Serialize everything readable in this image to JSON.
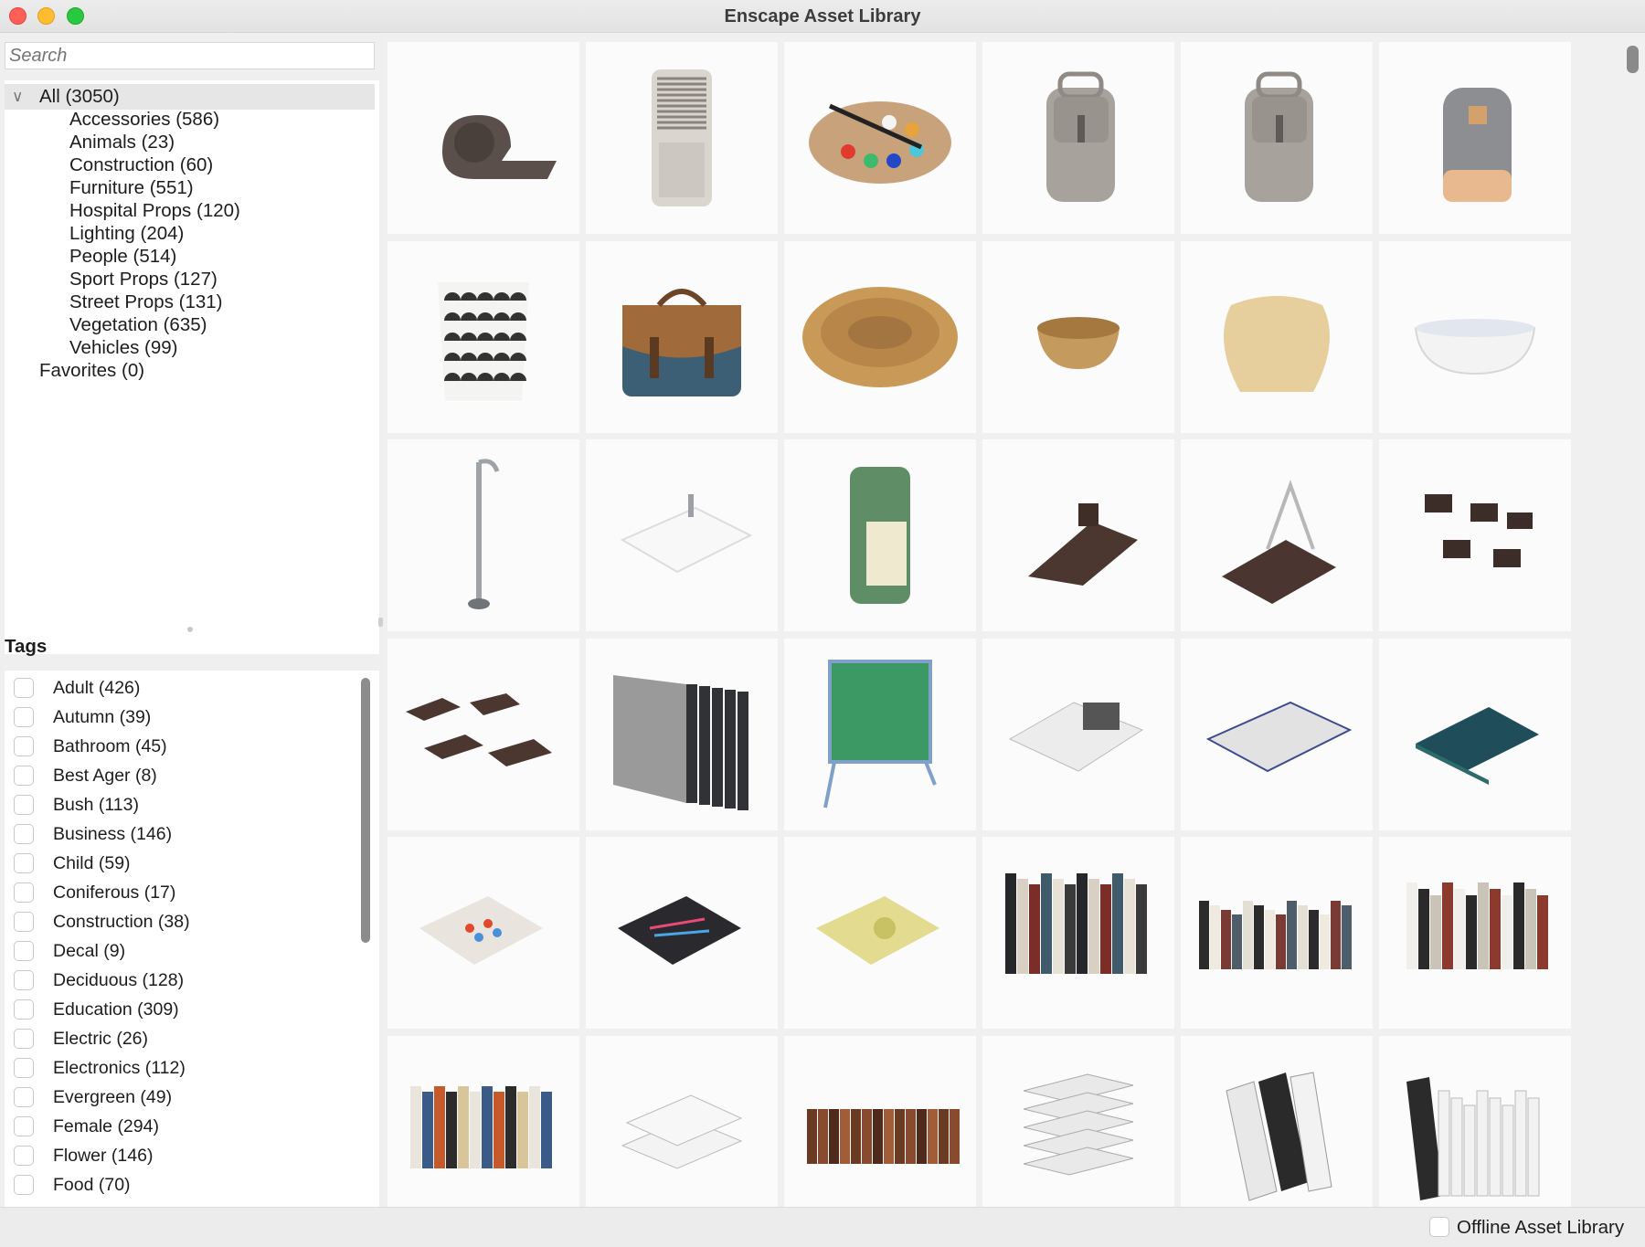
{
  "window": {
    "title": "Enscape Asset Library"
  },
  "search": {
    "placeholder": "Search"
  },
  "categories": {
    "all": "All (3050)",
    "items": [
      "Accessories (586)",
      "Animals (23)",
      "Construction (60)",
      "Furniture (551)",
      "Hospital Props (120)",
      "Lighting (204)",
      "People (514)",
      "Sport Props (127)",
      "Street Props (131)",
      "Vegetation (635)",
      "Vehicles (99)"
    ],
    "favorites": "Favorites (0)"
  },
  "tags": {
    "title": "Tags",
    "items": [
      "Adult (426)",
      "Autumn (39)",
      "Bathroom (45)",
      "Best Ager (8)",
      "Bush (113)",
      "Business (146)",
      "Child (59)",
      "Coniferous (17)",
      "Construction (38)",
      "Decal (9)",
      "Deciduous (128)",
      "Education (309)",
      "Electric (26)",
      "Electronics (112)",
      "Evergreen (49)",
      "Female (294)",
      "Flower (146)",
      "Food (70)"
    ]
  },
  "assets": [
    {
      "name": "tape-dispenser",
      "icon": "tape"
    },
    {
      "name": "air-cooler",
      "icon": "cooler"
    },
    {
      "name": "paint-palette",
      "icon": "palette"
    },
    {
      "name": "backpack-beige",
      "icon": "backpack"
    },
    {
      "name": "backpack-tan",
      "icon": "backpack"
    },
    {
      "name": "backpack-grey",
      "icon": "backpack2"
    },
    {
      "name": "laundry-basket",
      "icon": "hamper"
    },
    {
      "name": "messenger-bag",
      "icon": "bag"
    },
    {
      "name": "wicker-basket",
      "icon": "basket"
    },
    {
      "name": "small-bowl",
      "icon": "bowl"
    },
    {
      "name": "woven-basket",
      "icon": "pot"
    },
    {
      "name": "bathtub",
      "icon": "tub"
    },
    {
      "name": "floor-faucet",
      "icon": "faucet"
    },
    {
      "name": "sink",
      "icon": "sink"
    },
    {
      "name": "beverage-can",
      "icon": "can"
    },
    {
      "name": "clip",
      "icon": "clip"
    },
    {
      "name": "binder-clip",
      "icon": "binder"
    },
    {
      "name": "binder-clips-set",
      "icon": "clips"
    },
    {
      "name": "clips-scatter",
      "icon": "clips2"
    },
    {
      "name": "folders",
      "icon": "folders"
    },
    {
      "name": "chalkboard",
      "icon": "board"
    },
    {
      "name": "open-magazine",
      "icon": "magazine"
    },
    {
      "name": "open-book",
      "icon": "book"
    },
    {
      "name": "closed-book",
      "icon": "book2"
    },
    {
      "name": "book-colorful",
      "icon": "flatbook"
    },
    {
      "name": "book-dark",
      "icon": "flatbook2"
    },
    {
      "name": "book-yellow",
      "icon": "flatbook3"
    },
    {
      "name": "books-row-a",
      "icon": "booksrow"
    },
    {
      "name": "books-row-b",
      "icon": "booksrow2"
    },
    {
      "name": "books-row-c",
      "icon": "booksrow3"
    },
    {
      "name": "books-row-d",
      "icon": "booksrow4"
    },
    {
      "name": "books-stack",
      "icon": "stack"
    },
    {
      "name": "books-brown",
      "icon": "brownbooks"
    },
    {
      "name": "books-pile",
      "icon": "pile"
    },
    {
      "name": "books-leaning",
      "icon": "leaning"
    },
    {
      "name": "books-shelf",
      "icon": "shelf"
    }
  ],
  "status": {
    "offline_label": "Offline Asset Library",
    "offline_checked": false
  },
  "colors": {
    "accent": "#e6e6e6",
    "tile_bg": "#fbfbfb",
    "window_bg": "#f0f0f0"
  }
}
